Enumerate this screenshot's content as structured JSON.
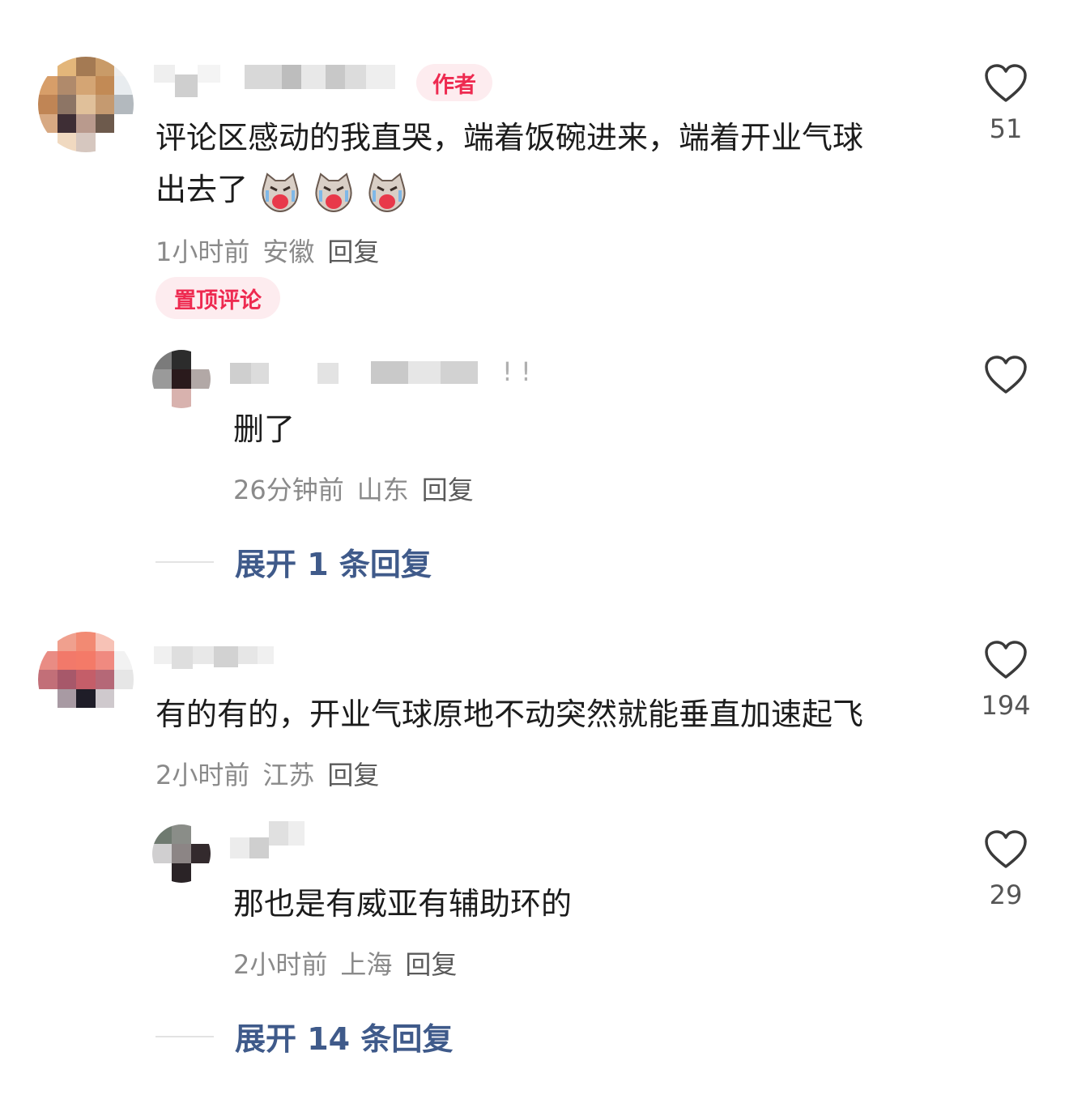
{
  "comments": [
    {
      "author_tag": "作者",
      "text_line1": "评论区感动的我直哭，端着饭碗进来，端着开业气球",
      "text_line2": "出去了",
      "emoji": "crying-cat-emoji",
      "time": "1小时前",
      "location": "安徽",
      "reply_label": "回复",
      "pinned_label": "置顶评论",
      "likes": "51",
      "reply": {
        "name_suffix": "!  !",
        "text": "删了",
        "time": "26分钟前",
        "location": "山东",
        "reply_label": "回复",
        "likes": ""
      },
      "expand_label": "展开 1 条回复"
    },
    {
      "text": "有的有的，开业气球原地不动突然就能垂直加速起飞",
      "time": "2小时前",
      "location": "江苏",
      "reply_label": "回复",
      "likes": "194",
      "reply": {
        "text": "那也是有威亚有辅助环的",
        "time": "2小时前",
        "location": "上海",
        "reply_label": "回复",
        "likes": "29"
      },
      "expand_label": "展开 14 条回复"
    }
  ],
  "colors": {
    "accent_red": "#ee2a50",
    "link_blue": "#3f5a8a",
    "meta_gray": "#8a8a8a"
  },
  "icons": {
    "like": "heart-outline-icon",
    "emoji": "crying-cat-emoji"
  }
}
